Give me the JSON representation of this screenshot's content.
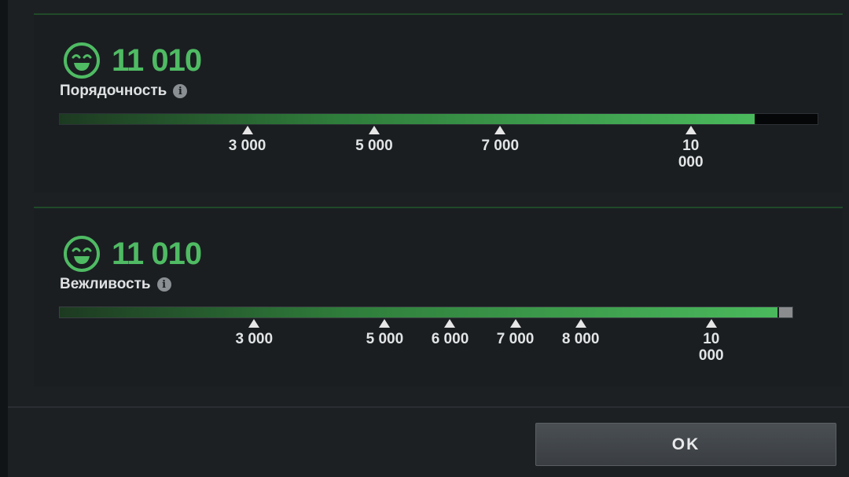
{
  "colors": {
    "accent_green": "#4fbb63",
    "bar_empty_primary": "#050607",
    "bar_empty_secondary": "#8a8c8e"
  },
  "panels": [
    {
      "icon": "smiley-face-icon",
      "score": "11 010",
      "label": "Порядочность",
      "info_icon": "info-icon",
      "progress_fraction": 0.915,
      "ticks": [
        {
          "label": "3 000",
          "fraction": 0.248,
          "wrap": false
        },
        {
          "label": "5 000",
          "fraction": 0.415,
          "wrap": false
        },
        {
          "label": "7 000",
          "fraction": 0.581,
          "wrap": false
        },
        {
          "label": "10 000",
          "fraction": 0.832,
          "wrap": true
        }
      ]
    },
    {
      "icon": "smiley-face-icon",
      "score": "11 010",
      "label": "Вежливость",
      "info_icon": "info-icon",
      "progress_fraction": 0.945,
      "ticks": [
        {
          "label": "3 000",
          "fraction": 0.257,
          "wrap": false
        },
        {
          "label": "5 000",
          "fraction": 0.429,
          "wrap": false
        },
        {
          "label": "6 000",
          "fraction": 0.515,
          "wrap": false
        },
        {
          "label": "7 000",
          "fraction": 0.601,
          "wrap": false
        },
        {
          "label": "8 000",
          "fraction": 0.687,
          "wrap": false
        },
        {
          "label": "10 000",
          "fraction": 0.859,
          "wrap": true
        }
      ]
    }
  ],
  "footer": {
    "ok_label": "OK"
  }
}
